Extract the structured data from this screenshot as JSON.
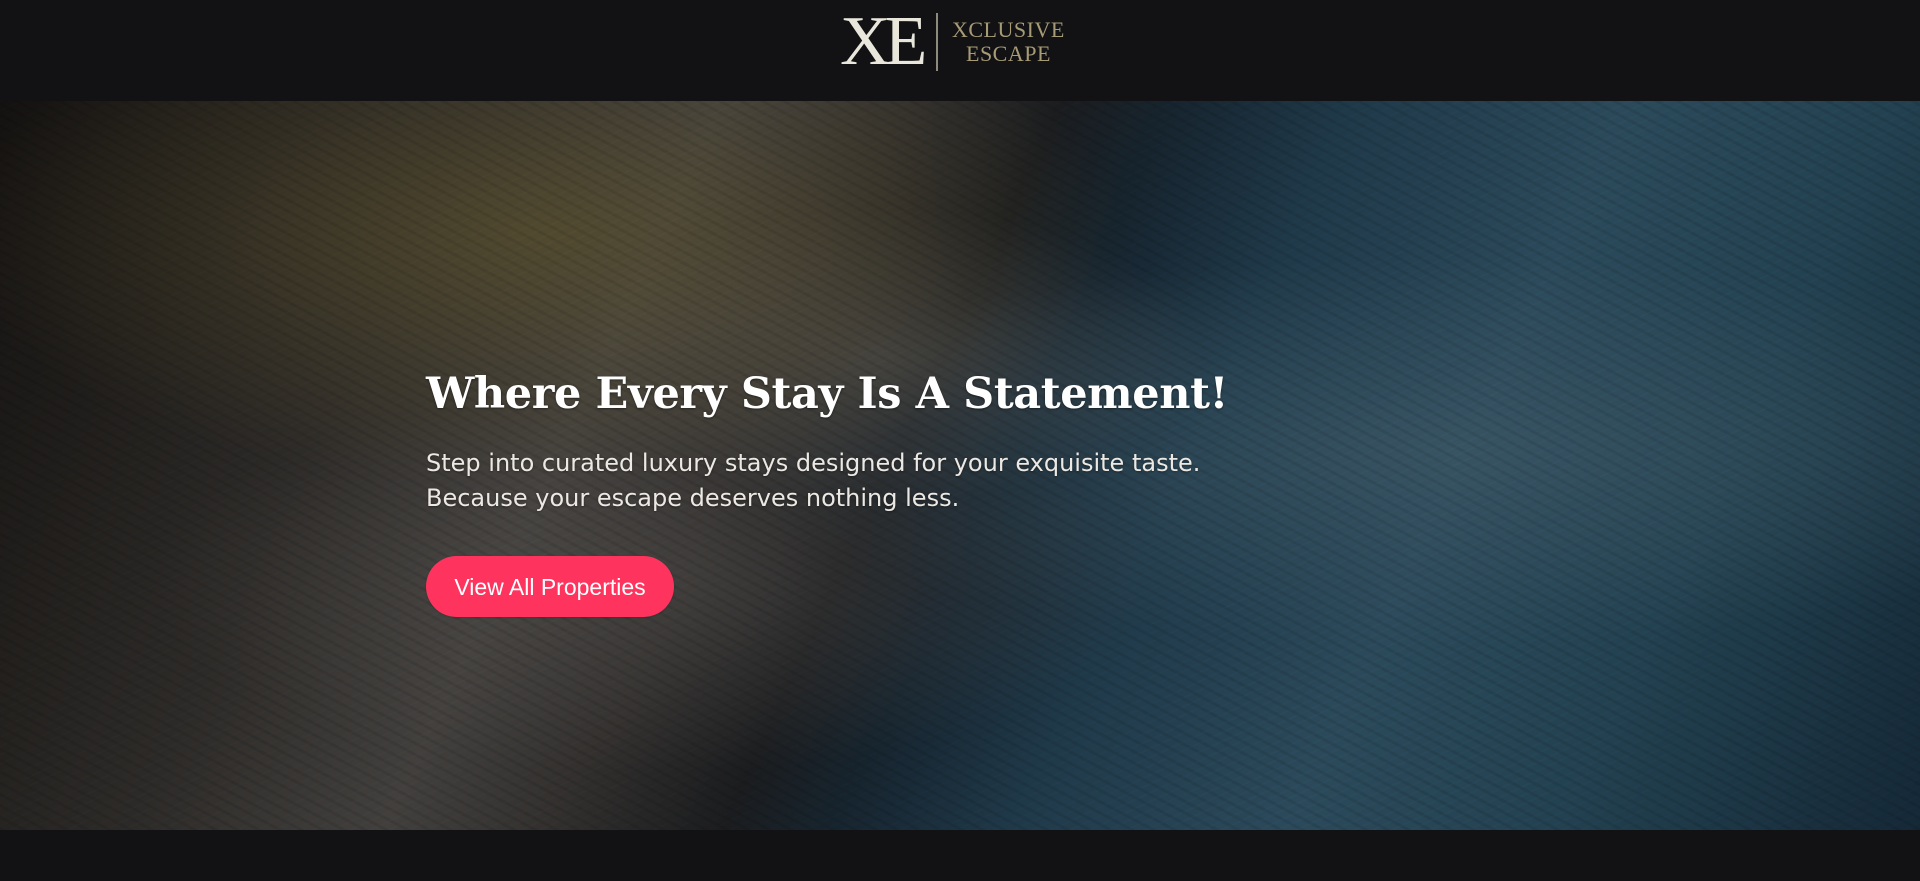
{
  "colors": {
    "page_background": "#121214",
    "brand_gold": "#a79b76",
    "cta_pink": "#ff345e"
  },
  "header": {
    "logo": {
      "mark": "XE",
      "line1": "Xclusive",
      "line2": "Escape"
    }
  },
  "hero": {
    "title": "Where Every Stay Is A Statement!",
    "subtitle_line1": "Step into curated luxury stays designed for your exquisite taste.",
    "subtitle_line2": "Because your escape deserves nothing less.",
    "cta_label": "View All Properties"
  }
}
